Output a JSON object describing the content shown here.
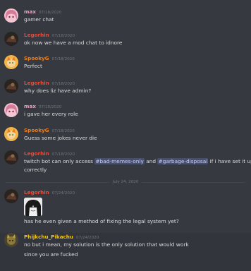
{
  "colors": {
    "background": "#36393f",
    "text": "#dcddde",
    "timestamp": "#72767d",
    "user_max": "#e9a0c0",
    "user_legorhin": "#e74c3c",
    "user_spooky": "#e67e22",
    "user_phijkchu": "#f1c40f",
    "mention": "#c9cdfb"
  },
  "messages": [
    {
      "username": "max",
      "timestamp": "07/18/2020",
      "avatar": "max-avatar-icon",
      "lines": [
        "gamer chat"
      ]
    },
    {
      "username": "Legorhin",
      "timestamp": "07/18/2020",
      "avatar": "legorhin-avatar-icon",
      "lines": [
        "ok now we have a mod chat to idnore"
      ]
    },
    {
      "username": "SpookyG",
      "timestamp": "07/18/2020",
      "avatar": "spooky-avatar-icon",
      "lines": [
        "Perfect"
      ]
    },
    {
      "username": "Legorhin",
      "timestamp": "07/18/2020",
      "avatar": "legorhin-avatar-icon",
      "lines": [
        "why does liz have admin?"
      ]
    },
    {
      "username": "max",
      "timestamp": "07/18/2020",
      "avatar": "max-avatar-icon",
      "lines": [
        "i gave her every role"
      ]
    },
    {
      "username": "SpookyG",
      "timestamp": "07/18/2020",
      "avatar": "spooky-avatar-icon",
      "lines": [
        "Guess some jokes never die"
      ]
    },
    {
      "username": "Legorhin",
      "timestamp": "07/18/2020",
      "avatar": "legorhin-avatar-icon",
      "line1_a": "twitch bot can only access ",
      "mention1": "#bad-memes-only",
      "line1_b": " and ",
      "mention2": "#garbage-disposal",
      "line1_c": " if i have set it up",
      "line2": "correctly"
    },
    {
      "username": "Legorhin",
      "timestamp": "07/24/2020",
      "avatar": "legorhin-avatar-icon",
      "attachment": "anime-reaction-image",
      "lines": [
        "has he even given a method of fixing the legal system yet?"
      ]
    },
    {
      "username": "Phijkchu_Pikachu",
      "timestamp": "07/24/2020",
      "avatar": "phijkchu-avatar-icon",
      "lines": [
        "no but i mean, my solution is the only solution that would work",
        "since you are fucked"
      ]
    }
  ],
  "divider": {
    "label": "July 24, 2020"
  }
}
